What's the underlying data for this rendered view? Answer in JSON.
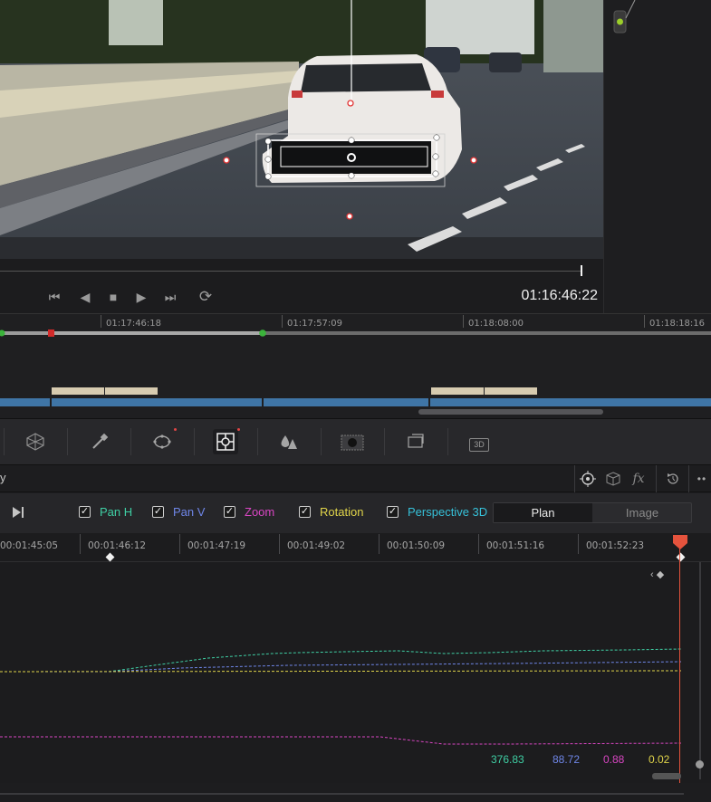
{
  "viewer": {
    "timecode": "01:16:46:22"
  },
  "transport": {
    "skip_back": "⏮",
    "step_back": "◀",
    "stop": "■",
    "play": "▶",
    "skip_forward": "⏭",
    "loop": "⟳"
  },
  "mini_timeline": {
    "ruler": [
      "01:17:46:18",
      "01:17:57:09",
      "01:18:08:00",
      "01:18:18:16"
    ]
  },
  "toolbar": {
    "tools": [
      "window-icon",
      "qualifier-icon",
      "power-window-icon",
      "tracker-icon",
      "blur-icon",
      "key-icon",
      "sizing-icon",
      "3d-icon"
    ],
    "label_3d": "3D"
  },
  "header": {
    "fx_label": "fx",
    "more": "••",
    "left_fragment": "y"
  },
  "channels": [
    {
      "label": "Pan H",
      "checked": true,
      "color": "#3fcfa4"
    },
    {
      "label": "Pan V",
      "checked": true,
      "color": "#6f86e8"
    },
    {
      "label": "Zoom",
      "checked": true,
      "color": "#d946c3"
    },
    {
      "label": "Rotation",
      "checked": true,
      "color": "#e0d44a"
    },
    {
      "label": "Perspective 3D",
      "checked": true,
      "color": "#36c0d8"
    }
  ],
  "mode": {
    "plan": "Plan",
    "image": "Image",
    "active": "Plan"
  },
  "graph": {
    "ruler": [
      "00:01:45:05",
      "00:01:46:12",
      "00:01:47:19",
      "00:01:49:02",
      "00:01:50:09",
      "00:01:51:16",
      "00:01:52:23"
    ],
    "values": {
      "pan_h": "376.83",
      "pan_v": "88.72",
      "zoom": "0.88",
      "rotation": "0.02"
    }
  }
}
